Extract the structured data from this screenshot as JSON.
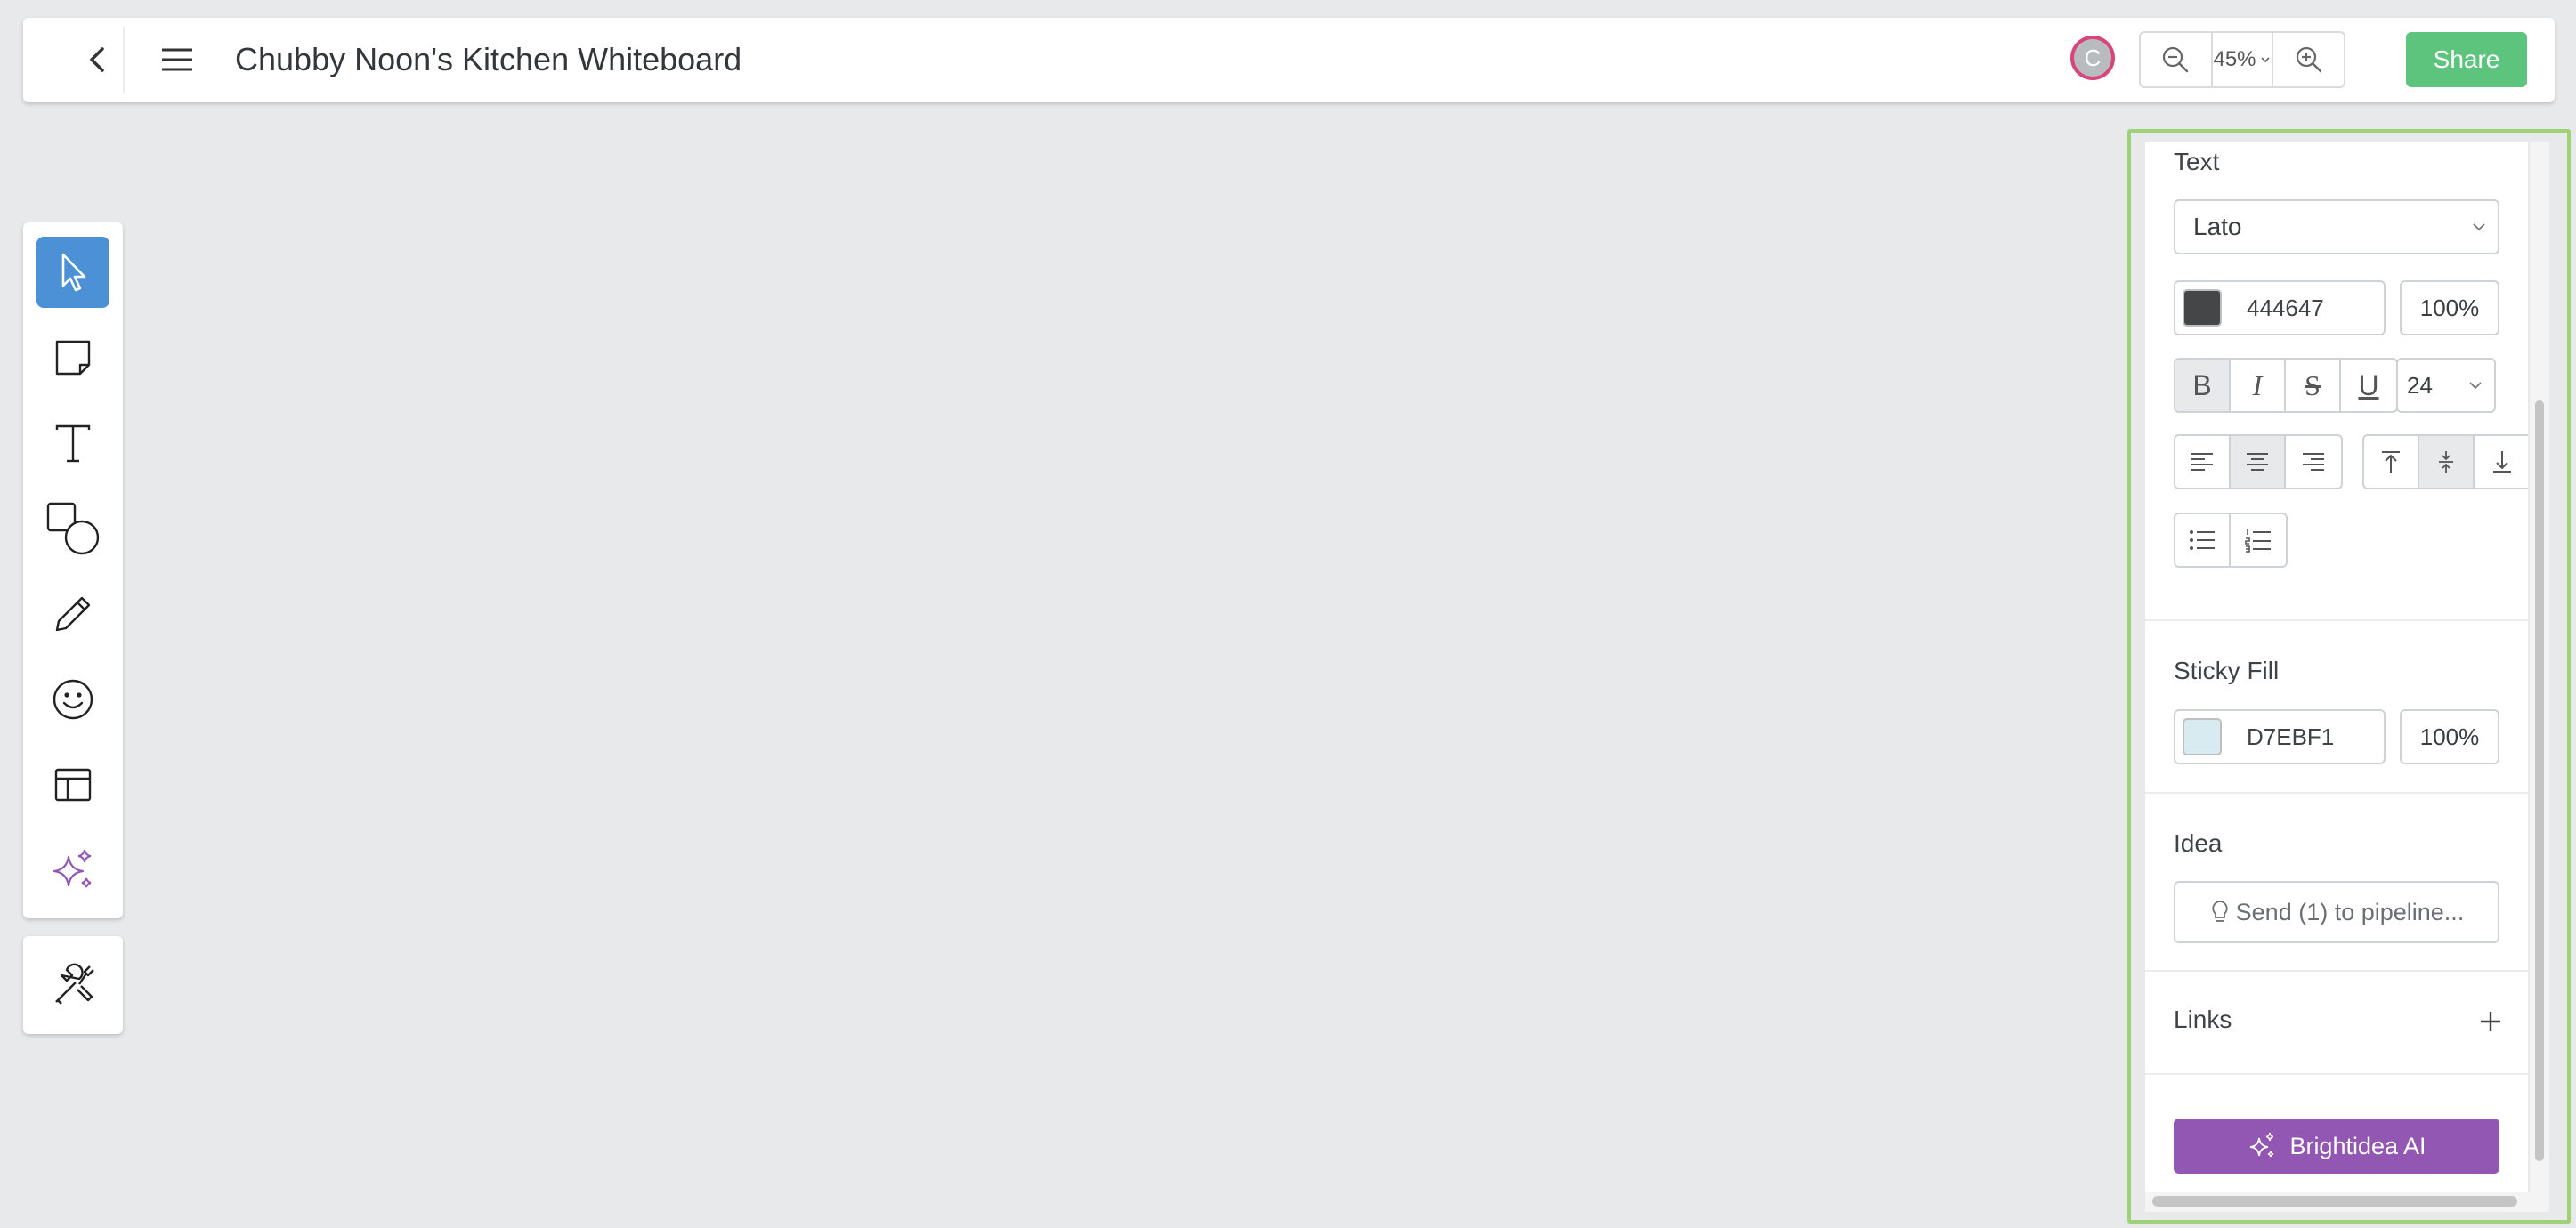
{
  "header": {
    "title": "Chubby Noon's Kitchen Whiteboard",
    "avatar_initial": "C",
    "zoom_level": "45%",
    "share_label": "Share",
    "icons": [
      "back-arrow-icon",
      "hamburger-menu-icon",
      "zoom-out-icon",
      "chevron-down-icon",
      "zoom-in-icon"
    ]
  },
  "toolbar": {
    "tools": [
      {
        "name": "select",
        "icon": "cursor-icon",
        "active": true
      },
      {
        "name": "sticky-note",
        "icon": "sticky-note-icon",
        "active": false
      },
      {
        "name": "text",
        "icon": "text-icon",
        "active": false
      },
      {
        "name": "shapes",
        "icon": "shapes-icon",
        "active": false
      },
      {
        "name": "pen",
        "icon": "pencil-icon",
        "active": false
      },
      {
        "name": "emoji",
        "icon": "smiley-icon",
        "active": false
      },
      {
        "name": "templates",
        "icon": "layout-icon",
        "active": false
      },
      {
        "name": "ai",
        "icon": "sparkles-icon",
        "active": false
      }
    ],
    "extra_tool": {
      "name": "tools",
      "icon": "wrench-screwdriver-icon"
    }
  },
  "panel": {
    "text": {
      "label": "Text",
      "font": "Lato",
      "color_hex": "444647",
      "color_value": "#444647",
      "opacity": "100%",
      "bold": "B",
      "italic": "I",
      "strike": "S",
      "underline": "U",
      "font_size": "24",
      "active_format": "bold",
      "active_align": "center",
      "active_valign": "middle"
    },
    "sticky_fill": {
      "label": "Sticky Fill",
      "color_hex": "D7EBF1",
      "color_value": "#D7EBF1",
      "opacity": "100%"
    },
    "idea": {
      "label": "Idea",
      "button_label": "Send (1) to pipeline..."
    },
    "links": {
      "label": "Links"
    },
    "ai_button_label": "Brightidea AI"
  },
  "colors": {
    "accent_blue": "#4c90d6",
    "share_green": "#5dc47d",
    "ai_purple": "#9157b3",
    "panel_highlight": "#9fd176",
    "avatar_ring": "#d8457b"
  }
}
